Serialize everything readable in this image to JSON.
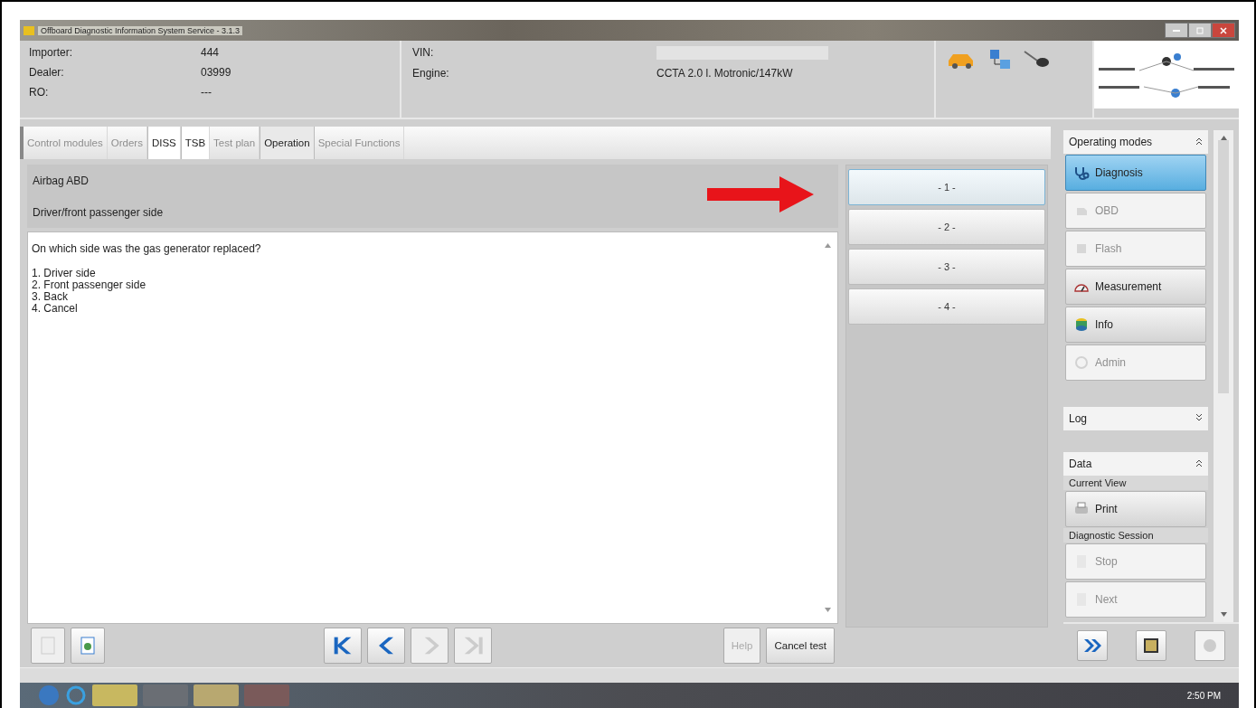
{
  "window": {
    "title": "Offboard Diagnostic Information System Service - 3.1.3"
  },
  "header": {
    "dealer_fields": [
      {
        "label": "Importer:",
        "value": "444"
      },
      {
        "label": "Dealer:",
        "value": "03999"
      },
      {
        "label": "RO:",
        "value": "---"
      }
    ],
    "vehicle_fields": [
      {
        "label": "VIN:",
        "redacted": true
      },
      {
        "label": "Engine:",
        "value": "CCTA 2.0 l. Motronic/147kW"
      }
    ]
  },
  "tabs": [
    {
      "label": "Control modules",
      "selected": false,
      "disabled": true
    },
    {
      "label": "Orders",
      "selected": false,
      "disabled": true
    },
    {
      "label": "DISS",
      "selected": false,
      "disabled": false
    },
    {
      "label": "TSB",
      "selected": false,
      "disabled": false
    },
    {
      "label": "Test plan",
      "selected": false,
      "disabled": true
    },
    {
      "label": "Operation",
      "selected": true,
      "disabled": false
    },
    {
      "label": "Special Functions",
      "selected": false,
      "disabled": true
    }
  ],
  "module": {
    "title": "Airbag ABD",
    "subtitle": "Driver/front passenger side"
  },
  "question": {
    "text": "On which side was the gas generator replaced?",
    "options": [
      "1. Driver side",
      "2. Front passenger side",
      "3. Back",
      "4. Cancel"
    ]
  },
  "answers": [
    {
      "label": "- 1 -",
      "selected": true
    },
    {
      "label": "- 2 -",
      "selected": false
    },
    {
      "label": "- 3 -",
      "selected": false
    },
    {
      "label": "- 4 -",
      "selected": false
    }
  ],
  "toolbar": {
    "nav": [
      {
        "kind": "first",
        "disabled": false
      },
      {
        "kind": "back",
        "disabled": false
      },
      {
        "kind": "forward",
        "disabled": true
      },
      {
        "kind": "last",
        "disabled": true
      }
    ],
    "buttons": [
      {
        "label": "Help",
        "disabled": true
      },
      {
        "label": "Cancel test",
        "disabled": false
      }
    ]
  },
  "sidebar": {
    "operating_modes": {
      "title": "Operating modes",
      "expanded": true,
      "items": [
        {
          "label": "Diagnosis",
          "kind": "diagnosis",
          "selected": true,
          "disabled": false
        },
        {
          "label": "OBD",
          "kind": "obd",
          "selected": false,
          "disabled": true
        },
        {
          "label": "Flash",
          "kind": "flash",
          "selected": false,
          "disabled": true
        },
        {
          "label": "Measurement",
          "kind": "measurement",
          "selected": false,
          "disabled": false
        },
        {
          "label": "Info",
          "kind": "info",
          "selected": false,
          "disabled": false
        },
        {
          "label": "Admin",
          "kind": "admin",
          "selected": false,
          "disabled": true
        }
      ]
    },
    "log": {
      "title": "Log",
      "expanded": false
    },
    "data": {
      "title": "Data",
      "expanded": true,
      "groups": [
        {
          "title": "Current View",
          "items": [
            {
              "label": "Print",
              "kind": "print",
              "disabled": false
            }
          ]
        },
        {
          "title": "Diagnostic Session",
          "items": [
            {
              "label": "Stop",
              "kind": "stop",
              "disabled": true
            },
            {
              "label": "Next",
              "kind": "next",
              "disabled": true
            }
          ]
        }
      ]
    }
  },
  "taskbar": {
    "time": "2:50 PM"
  }
}
